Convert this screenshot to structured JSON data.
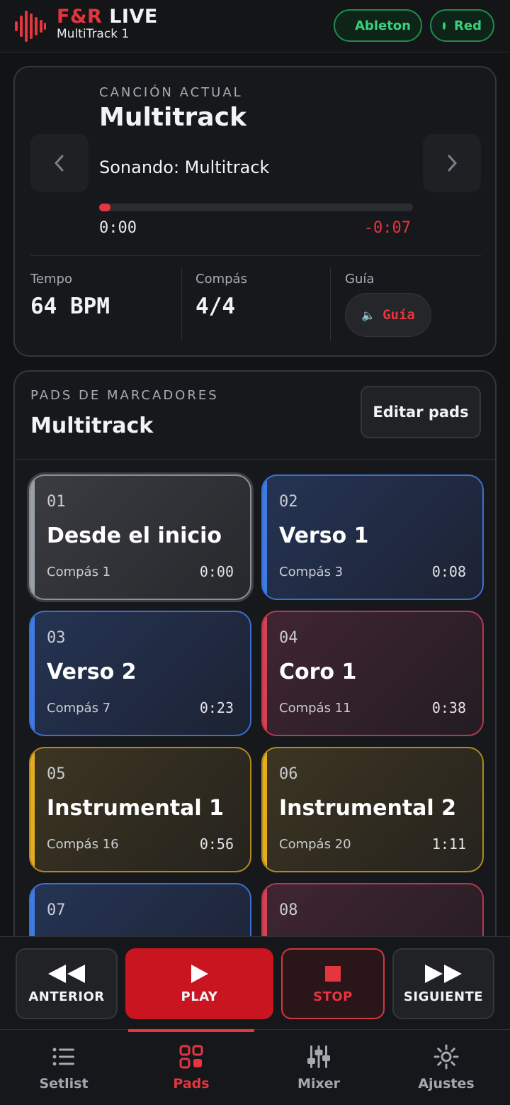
{
  "header": {
    "brand_prefix": "F&R",
    "brand_suffix": "LIVE",
    "subtitle": "MultiTrack 1",
    "status_ableton": "Ableton",
    "status_red": "Red"
  },
  "song": {
    "label": "CANCIÓN ACTUAL",
    "title": "Multitrack",
    "playing": "Sonando: Multitrack",
    "elapsed": "0:00",
    "remaining": "-0:07",
    "progress_percent": 3.5,
    "prev_icon": "chevron-left-icon",
    "next_icon": "chevron-right-icon",
    "tempo_label": "Tempo",
    "tempo_value": "64 BPM",
    "compas_label": "Compás",
    "compas_value": "4/4",
    "guia_label": "Guía",
    "guia_button": "Guía"
  },
  "pads_section": {
    "label": "PADS DE MARCADORES",
    "title": "Multitrack",
    "edit_button": "Editar pads"
  },
  "pads": [
    {
      "num": "01",
      "name": "Desde el inicio",
      "bar": "Compás 1",
      "time": "0:00",
      "color": "gray"
    },
    {
      "num": "02",
      "name": "Verso 1",
      "bar": "Compás 3",
      "time": "0:08",
      "color": "blue"
    },
    {
      "num": "03",
      "name": "Verso 2",
      "bar": "Compás 7",
      "time": "0:23",
      "color": "blue"
    },
    {
      "num": "04",
      "name": "Coro 1",
      "bar": "Compás 11",
      "time": "0:38",
      "color": "red"
    },
    {
      "num": "05",
      "name": "Instrumental 1",
      "bar": "Compás 16",
      "time": "0:56",
      "color": "gold"
    },
    {
      "num": "06",
      "name": "Instrumental 2",
      "bar": "Compás 20",
      "time": "1:11",
      "color": "gold"
    },
    {
      "num": "07",
      "name": "",
      "bar": "",
      "time": "",
      "color": "blue"
    },
    {
      "num": "08",
      "name": "",
      "bar": "",
      "time": "",
      "color": "red"
    }
  ],
  "transport": {
    "prev": "ANTERIOR",
    "play": "PLAY",
    "stop": "STOP",
    "next": "SIGUIENTE"
  },
  "nav": {
    "setlist": "Setlist",
    "pads": "Pads",
    "mixer": "Mixer",
    "ajustes": "Ajustes"
  },
  "colors": {
    "accent": "#e5353f",
    "connected": "#39d07b",
    "pad_gray": "#8c9096",
    "pad_blue": "#3b6fd1",
    "pad_red": "#b53a4c",
    "pad_gold": "#b3891d"
  }
}
